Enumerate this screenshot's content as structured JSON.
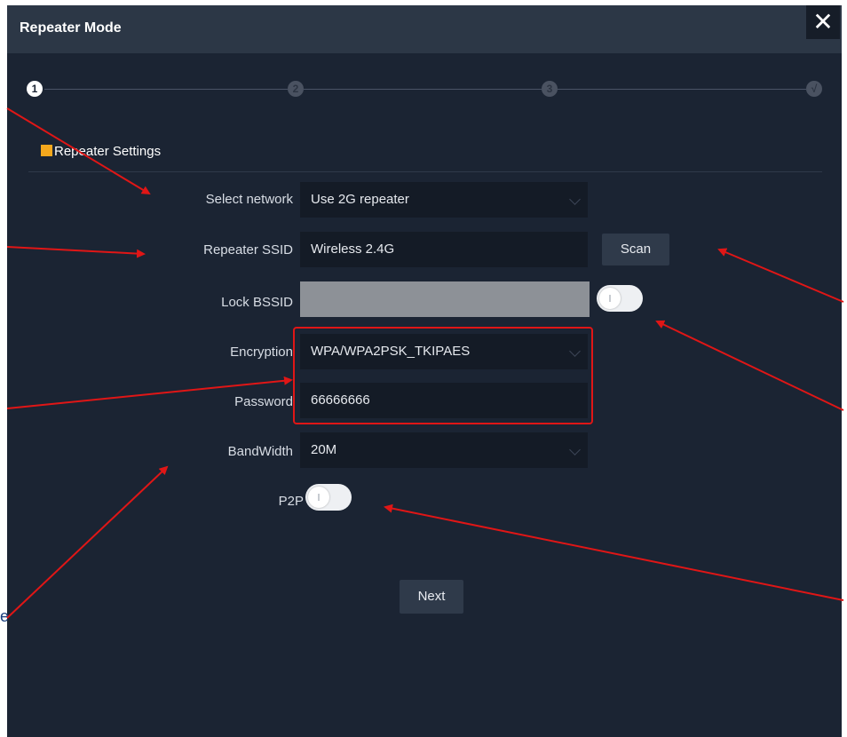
{
  "dialog": {
    "title": "Repeater Mode",
    "close_icon": "close-icon"
  },
  "steps": [
    "1",
    "2",
    "3",
    "√"
  ],
  "section": {
    "title": "Repeater Settings"
  },
  "form": {
    "select_network": {
      "label": "Select network",
      "value": "Use 2G repeater"
    },
    "repeater_ssid": {
      "label": "Repeater SSID",
      "value": "Wireless 2.4G",
      "scan_label": "Scan"
    },
    "lock_bssid": {
      "label": "Lock BSSID",
      "value": ""
    },
    "encryption": {
      "label": "Encryption",
      "value": "WPA/WPA2PSK_TKIPAES"
    },
    "password": {
      "label": "Password",
      "value": "66666666"
    },
    "bandwidth": {
      "label": "BandWidth",
      "value": "20M"
    },
    "p2p": {
      "label": "P2P"
    }
  },
  "next_label": "Next",
  "colors": {
    "dialog_bg": "#1b2433",
    "titlebar_bg": "#2c3746",
    "accent": "#f5a81d",
    "annotation": "#e01616"
  }
}
